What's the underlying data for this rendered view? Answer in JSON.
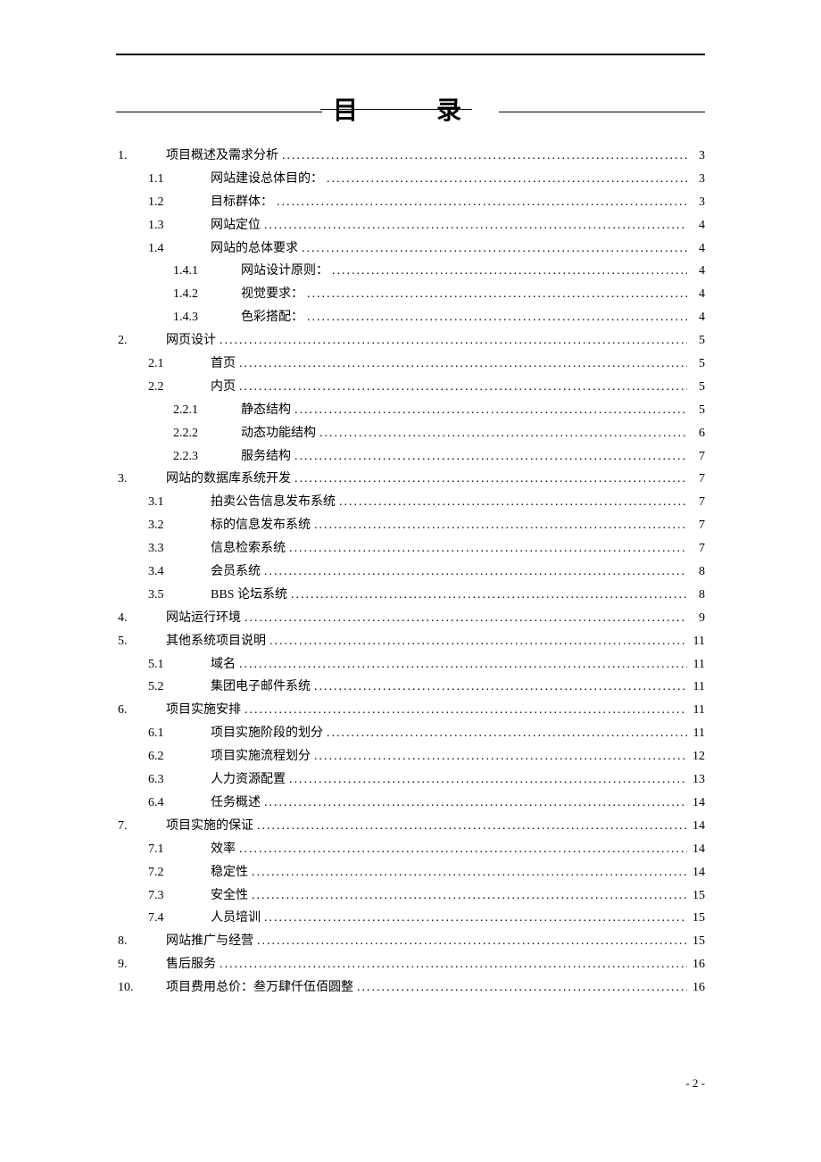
{
  "heading": "目　录",
  "page_footer": "- 2 -",
  "toc": [
    {
      "level": 1,
      "num": "1.",
      "label": "项目概述及需求分析",
      "page": "3"
    },
    {
      "level": 2,
      "num": "1.1",
      "label": "网站建设总体目的：",
      "page": "3"
    },
    {
      "level": 2,
      "num": "1.2",
      "label": "目标群体：",
      "page": "3"
    },
    {
      "level": 2,
      "num": "1.3",
      "label": "网站定位",
      "page": "4"
    },
    {
      "level": 2,
      "num": "1.4",
      "label": "网站的总体要求",
      "page": "4"
    },
    {
      "level": 3,
      "num": "1.4.1",
      "label": "网站设计原则：",
      "page": "4"
    },
    {
      "level": 3,
      "num": "1.4.2",
      "label": "视觉要求：",
      "page": "4"
    },
    {
      "level": 3,
      "num": "1.4.3",
      "label": "色彩搭配：",
      "page": "4"
    },
    {
      "level": 1,
      "num": "2.",
      "label": "网页设计",
      "page": "5"
    },
    {
      "level": 2,
      "num": "2.1",
      "label": "首页",
      "page": "5"
    },
    {
      "level": 2,
      "num": "2.2",
      "label": "内页",
      "page": "5"
    },
    {
      "level": 3,
      "num": "2.2.1",
      "label": "静态结构",
      "page": "5"
    },
    {
      "level": 3,
      "num": "2.2.2",
      "label": "动态功能结构",
      "page": "6"
    },
    {
      "level": 3,
      "num": "2.2.3",
      "label": "服务结构",
      "page": "7"
    },
    {
      "level": 1,
      "num": "3.",
      "label": "网站的数据库系统开发",
      "page": "7"
    },
    {
      "level": 2,
      "num": "3.1",
      "label": "拍卖公告信息发布系统",
      "page": "7"
    },
    {
      "level": 2,
      "num": "3.2",
      "label": "标的信息发布系统",
      "page": "7"
    },
    {
      "level": 2,
      "num": "3.3",
      "label": "信息检索系统",
      "page": "7"
    },
    {
      "level": 2,
      "num": "3.4",
      "label": "会员系统",
      "page": "8"
    },
    {
      "level": 2,
      "num": "3.5",
      "label": "BBS 论坛系统",
      "page": "8"
    },
    {
      "level": 1,
      "num": "4.",
      "label": "网站运行环境",
      "page": "9"
    },
    {
      "level": 1,
      "num": "5.",
      "label": "其他系统项目说明",
      "page": "11"
    },
    {
      "level": 2,
      "num": "5.1",
      "label": "域名",
      "page": "11"
    },
    {
      "level": 2,
      "num": "5.2",
      "label": "集团电子邮件系统",
      "page": "11"
    },
    {
      "level": 1,
      "num": "6.",
      "label": "项目实施安排",
      "page": "11"
    },
    {
      "level": 2,
      "num": "6.1",
      "label": "项目实施阶段的划分",
      "page": "11"
    },
    {
      "level": 2,
      "num": "6.2",
      "label": "项目实施流程划分",
      "page": "12"
    },
    {
      "level": 2,
      "num": "6.3",
      "label": "人力资源配置",
      "page": "13"
    },
    {
      "level": 2,
      "num": "6.4",
      "label": "任务概述",
      "page": "14"
    },
    {
      "level": 1,
      "num": "7.",
      "label": "项目实施的保证",
      "page": "14"
    },
    {
      "level": 2,
      "num": "7.1",
      "label": "效率",
      "page": "14"
    },
    {
      "level": 2,
      "num": "7.2",
      "label": "稳定性",
      "page": "14"
    },
    {
      "level": 2,
      "num": "7.3",
      "label": "安全性",
      "page": "15"
    },
    {
      "level": 2,
      "num": "7.4",
      "label": "人员培训",
      "page": "15"
    },
    {
      "level": 1,
      "num": "8.",
      "label": "网站推广与经营",
      "page": "15"
    },
    {
      "level": 1,
      "num": "9.",
      "label": "售后服务",
      "page": "16"
    },
    {
      "level": 1,
      "num": "10.",
      "label": "项目费用总价：叁万肆仟伍佰圆整",
      "page": "16"
    }
  ]
}
